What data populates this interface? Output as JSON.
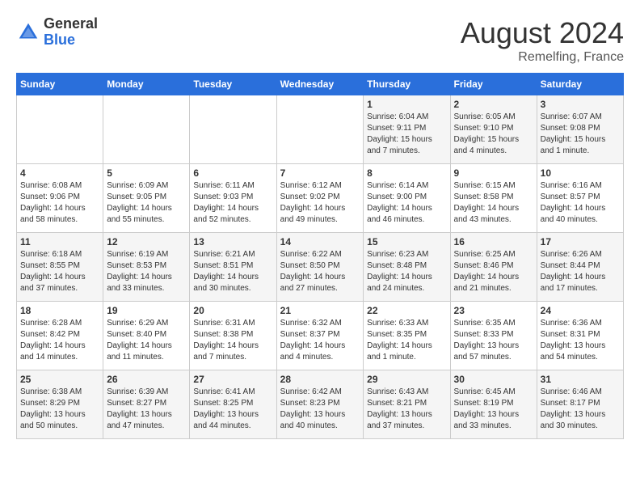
{
  "header": {
    "logo_general": "General",
    "logo_blue": "Blue",
    "month": "August 2024",
    "location": "Remelfing, France"
  },
  "days_of_week": [
    "Sunday",
    "Monday",
    "Tuesday",
    "Wednesday",
    "Thursday",
    "Friday",
    "Saturday"
  ],
  "weeks": [
    [
      {
        "day": "",
        "info": ""
      },
      {
        "day": "",
        "info": ""
      },
      {
        "day": "",
        "info": ""
      },
      {
        "day": "",
        "info": ""
      },
      {
        "day": "1",
        "info": "Sunrise: 6:04 AM\nSunset: 9:11 PM\nDaylight: 15 hours\nand 7 minutes."
      },
      {
        "day": "2",
        "info": "Sunrise: 6:05 AM\nSunset: 9:10 PM\nDaylight: 15 hours\nand 4 minutes."
      },
      {
        "day": "3",
        "info": "Sunrise: 6:07 AM\nSunset: 9:08 PM\nDaylight: 15 hours\nand 1 minute."
      }
    ],
    [
      {
        "day": "4",
        "info": "Sunrise: 6:08 AM\nSunset: 9:06 PM\nDaylight: 14 hours\nand 58 minutes."
      },
      {
        "day": "5",
        "info": "Sunrise: 6:09 AM\nSunset: 9:05 PM\nDaylight: 14 hours\nand 55 minutes."
      },
      {
        "day": "6",
        "info": "Sunrise: 6:11 AM\nSunset: 9:03 PM\nDaylight: 14 hours\nand 52 minutes."
      },
      {
        "day": "7",
        "info": "Sunrise: 6:12 AM\nSunset: 9:02 PM\nDaylight: 14 hours\nand 49 minutes."
      },
      {
        "day": "8",
        "info": "Sunrise: 6:14 AM\nSunset: 9:00 PM\nDaylight: 14 hours\nand 46 minutes."
      },
      {
        "day": "9",
        "info": "Sunrise: 6:15 AM\nSunset: 8:58 PM\nDaylight: 14 hours\nand 43 minutes."
      },
      {
        "day": "10",
        "info": "Sunrise: 6:16 AM\nSunset: 8:57 PM\nDaylight: 14 hours\nand 40 minutes."
      }
    ],
    [
      {
        "day": "11",
        "info": "Sunrise: 6:18 AM\nSunset: 8:55 PM\nDaylight: 14 hours\nand 37 minutes."
      },
      {
        "day": "12",
        "info": "Sunrise: 6:19 AM\nSunset: 8:53 PM\nDaylight: 14 hours\nand 33 minutes."
      },
      {
        "day": "13",
        "info": "Sunrise: 6:21 AM\nSunset: 8:51 PM\nDaylight: 14 hours\nand 30 minutes."
      },
      {
        "day": "14",
        "info": "Sunrise: 6:22 AM\nSunset: 8:50 PM\nDaylight: 14 hours\nand 27 minutes."
      },
      {
        "day": "15",
        "info": "Sunrise: 6:23 AM\nSunset: 8:48 PM\nDaylight: 14 hours\nand 24 minutes."
      },
      {
        "day": "16",
        "info": "Sunrise: 6:25 AM\nSunset: 8:46 PM\nDaylight: 14 hours\nand 21 minutes."
      },
      {
        "day": "17",
        "info": "Sunrise: 6:26 AM\nSunset: 8:44 PM\nDaylight: 14 hours\nand 17 minutes."
      }
    ],
    [
      {
        "day": "18",
        "info": "Sunrise: 6:28 AM\nSunset: 8:42 PM\nDaylight: 14 hours\nand 14 minutes."
      },
      {
        "day": "19",
        "info": "Sunrise: 6:29 AM\nSunset: 8:40 PM\nDaylight: 14 hours\nand 11 minutes."
      },
      {
        "day": "20",
        "info": "Sunrise: 6:31 AM\nSunset: 8:38 PM\nDaylight: 14 hours\nand 7 minutes."
      },
      {
        "day": "21",
        "info": "Sunrise: 6:32 AM\nSunset: 8:37 PM\nDaylight: 14 hours\nand 4 minutes."
      },
      {
        "day": "22",
        "info": "Sunrise: 6:33 AM\nSunset: 8:35 PM\nDaylight: 14 hours\nand 1 minute."
      },
      {
        "day": "23",
        "info": "Sunrise: 6:35 AM\nSunset: 8:33 PM\nDaylight: 13 hours\nand 57 minutes."
      },
      {
        "day": "24",
        "info": "Sunrise: 6:36 AM\nSunset: 8:31 PM\nDaylight: 13 hours\nand 54 minutes."
      }
    ],
    [
      {
        "day": "25",
        "info": "Sunrise: 6:38 AM\nSunset: 8:29 PM\nDaylight: 13 hours\nand 50 minutes."
      },
      {
        "day": "26",
        "info": "Sunrise: 6:39 AM\nSunset: 8:27 PM\nDaylight: 13 hours\nand 47 minutes."
      },
      {
        "day": "27",
        "info": "Sunrise: 6:41 AM\nSunset: 8:25 PM\nDaylight: 13 hours\nand 44 minutes."
      },
      {
        "day": "28",
        "info": "Sunrise: 6:42 AM\nSunset: 8:23 PM\nDaylight: 13 hours\nand 40 minutes."
      },
      {
        "day": "29",
        "info": "Sunrise: 6:43 AM\nSunset: 8:21 PM\nDaylight: 13 hours\nand 37 minutes."
      },
      {
        "day": "30",
        "info": "Sunrise: 6:45 AM\nSunset: 8:19 PM\nDaylight: 13 hours\nand 33 minutes."
      },
      {
        "day": "31",
        "info": "Sunrise: 6:46 AM\nSunset: 8:17 PM\nDaylight: 13 hours\nand 30 minutes."
      }
    ]
  ]
}
